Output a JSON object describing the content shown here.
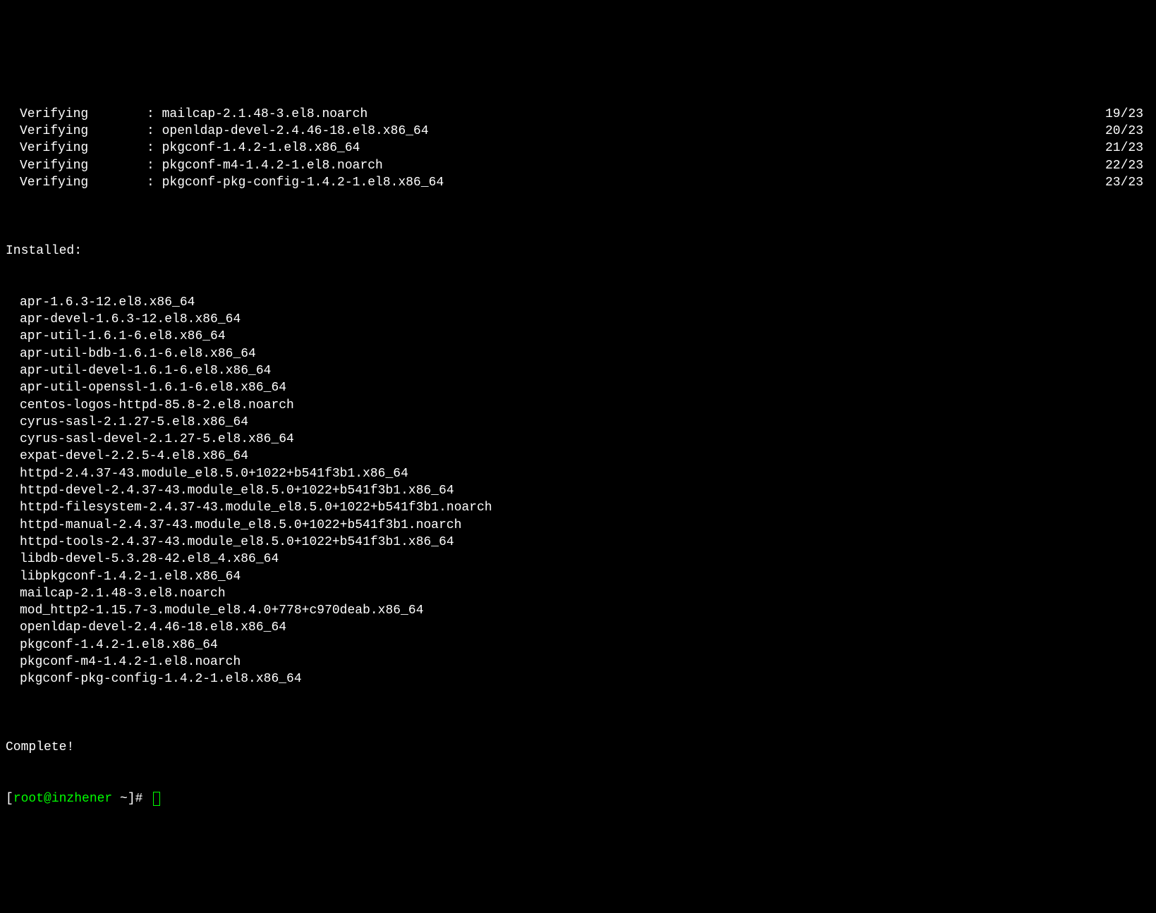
{
  "verify_label": "Verifying",
  "verifying": [
    {
      "package": "mailcap-2.1.48-3.el8.noarch",
      "count": "19/23"
    },
    {
      "package": "openldap-devel-2.4.46-18.el8.x86_64",
      "count": "20/23"
    },
    {
      "package": "pkgconf-1.4.2-1.el8.x86_64",
      "count": "21/23"
    },
    {
      "package": "pkgconf-m4-1.4.2-1.el8.noarch",
      "count": "22/23"
    },
    {
      "package": "pkgconf-pkg-config-1.4.2-1.el8.x86_64",
      "count": "23/23"
    }
  ],
  "installed_header": "Installed:",
  "installed": [
    "apr-1.6.3-12.el8.x86_64",
    "apr-devel-1.6.3-12.el8.x86_64",
    "apr-util-1.6.1-6.el8.x86_64",
    "apr-util-bdb-1.6.1-6.el8.x86_64",
    "apr-util-devel-1.6.1-6.el8.x86_64",
    "apr-util-openssl-1.6.1-6.el8.x86_64",
    "centos-logos-httpd-85.8-2.el8.noarch",
    "cyrus-sasl-2.1.27-5.el8.x86_64",
    "cyrus-sasl-devel-2.1.27-5.el8.x86_64",
    "expat-devel-2.2.5-4.el8.x86_64",
    "httpd-2.4.37-43.module_el8.5.0+1022+b541f3b1.x86_64",
    "httpd-devel-2.4.37-43.module_el8.5.0+1022+b541f3b1.x86_64",
    "httpd-filesystem-2.4.37-43.module_el8.5.0+1022+b541f3b1.noarch",
    "httpd-manual-2.4.37-43.module_el8.5.0+1022+b541f3b1.noarch",
    "httpd-tools-2.4.37-43.module_el8.5.0+1022+b541f3b1.x86_64",
    "libdb-devel-5.3.28-42.el8_4.x86_64",
    "libpkgconf-1.4.2-1.el8.x86_64",
    "mailcap-2.1.48-3.el8.noarch",
    "mod_http2-1.15.7-3.module_el8.4.0+778+c970deab.x86_64",
    "openldap-devel-2.4.46-18.el8.x86_64",
    "pkgconf-1.4.2-1.el8.x86_64",
    "pkgconf-m4-1.4.2-1.el8.noarch",
    "pkgconf-pkg-config-1.4.2-1.el8.x86_64"
  ],
  "complete": "Complete!",
  "prompt": {
    "open_bracket": "[",
    "user_host": "root@inzhener",
    "path": " ~",
    "close_bracket": "]# "
  }
}
